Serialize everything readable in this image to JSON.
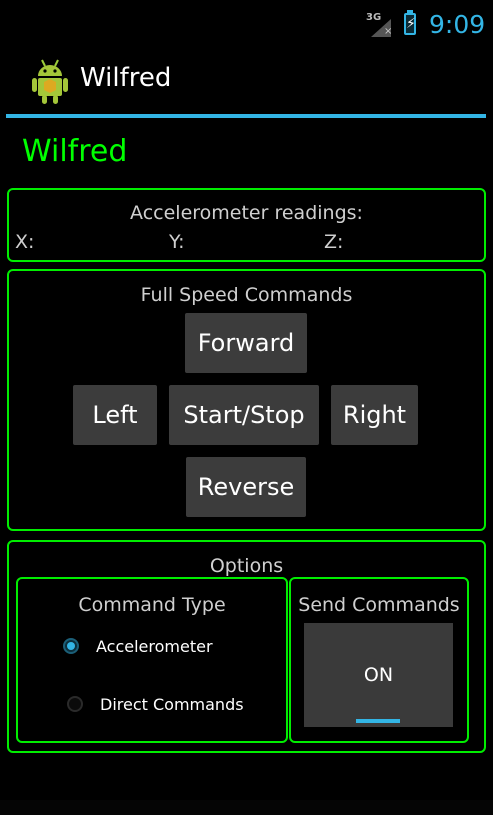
{
  "status_bar": {
    "network": "3G",
    "time": "9:09"
  },
  "action_bar": {
    "title": "Wilfred"
  },
  "page": {
    "heading": "Wilfred"
  },
  "accelerometer": {
    "title": "Accelerometer readings:",
    "x_label": "X:",
    "y_label": "Y:",
    "z_label": "Z:"
  },
  "full_speed": {
    "title": "Full Speed Commands",
    "forward": "Forward",
    "left": "Left",
    "start_stop": "Start/Stop",
    "right": "Right",
    "reverse": "Reverse"
  },
  "options": {
    "title": "Options",
    "command_type": {
      "title": "Command Type",
      "options": [
        {
          "label": "Accelerometer",
          "selected": true
        },
        {
          "label": "Direct Commands",
          "selected": false
        }
      ]
    },
    "send_commands": {
      "title": "Send Commands",
      "toggle_label": "ON",
      "toggle_state": true
    }
  },
  "colors": {
    "accent": "#33b5e5",
    "heading_green": "#00ff00",
    "panel_border": "#00ee00"
  }
}
